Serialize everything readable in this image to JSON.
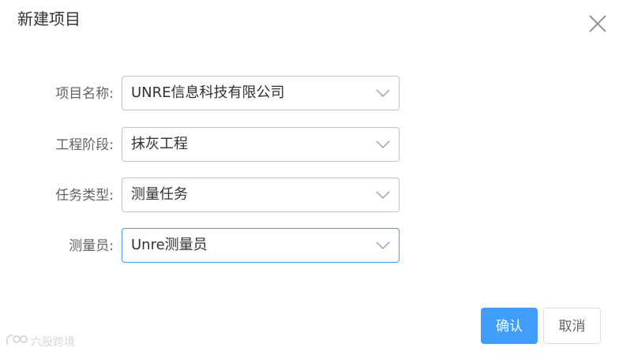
{
  "dialog": {
    "title": "新建项目",
    "close_icon": "close-icon"
  },
  "form": {
    "fields": [
      {
        "label": "项目名称:",
        "value": "UNRE信息科技有限公司"
      },
      {
        "label": "工程阶段:",
        "value": "抹灰工程"
      },
      {
        "label": "任务类型:",
        "value": "测量任务"
      },
      {
        "label": "测量员:",
        "value": "Unre测量员"
      }
    ]
  },
  "actions": {
    "confirm_label": "确认",
    "cancel_label": "取消"
  },
  "watermark": {
    "text": "六股跨境"
  },
  "colors": {
    "primary": "#409eff",
    "border": "#c0c4cc",
    "text": "#303133",
    "label": "#606266"
  }
}
